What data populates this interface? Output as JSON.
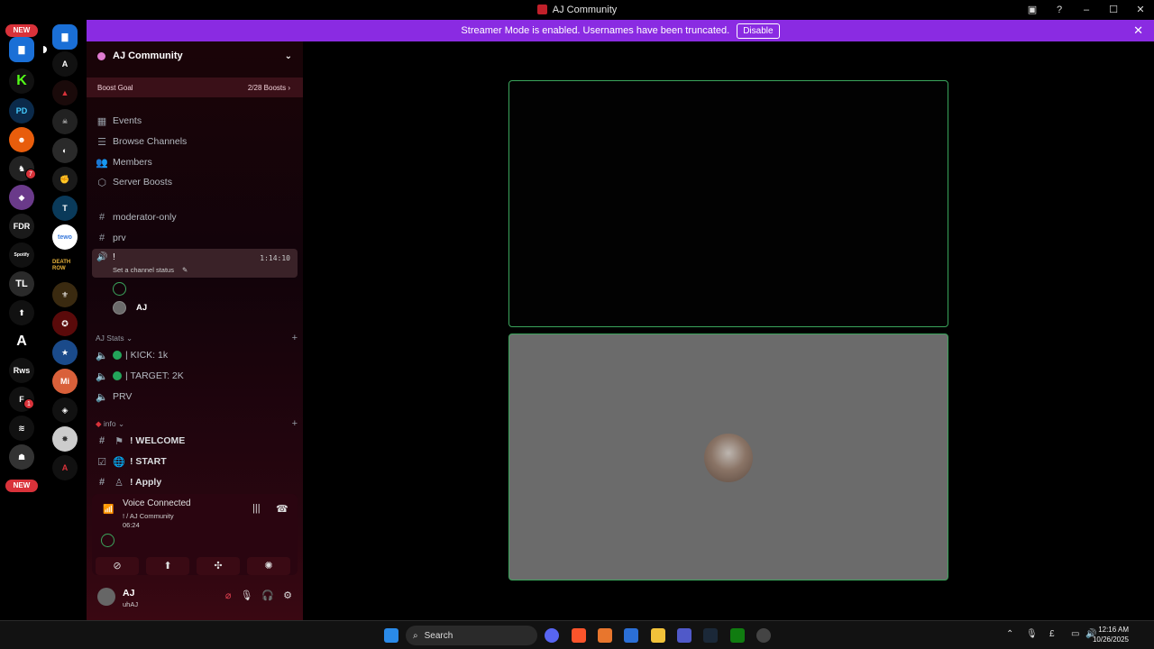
{
  "window": {
    "title": "AJ Community"
  },
  "banner": {
    "text": "Streamer Mode is enabled. Usernames have been truncated.",
    "disable_label": "Disable"
  },
  "rail": {
    "new_top": "NEW",
    "new_bottom": "NEW",
    "fdr": "FDR",
    "tl": "TL",
    "pd": "PD",
    "rws": "Rws",
    "death_row": "DEATH ROW",
    "mi": "Mi",
    "badge_7": "7",
    "badge_1": "1",
    "spotify": "Spotify",
    "tewo": "tewo"
  },
  "sidebar": {
    "server_name": "AJ Community",
    "boost_goal": "Boost Goal",
    "boost_count": "2/28 Boosts",
    "menu": [
      {
        "label": "Events",
        "icon": "calendar-icon"
      },
      {
        "label": "Browse Channels",
        "icon": "list-icon"
      },
      {
        "label": "Members",
        "icon": "members-icon"
      },
      {
        "label": "Server Boosts",
        "icon": "boost-icon"
      }
    ],
    "channels_top": [
      "moderator-only",
      "prv"
    ],
    "active_voice": {
      "name": "!",
      "status": "Set a channel status",
      "time": "1:14:10"
    },
    "voice_members": [
      "",
      "AJ"
    ],
    "cat_stats": "AJ Stats",
    "stats_channels": [
      "| KICK: 1k",
      "| TARGET: 2K",
      "PRV"
    ],
    "cat_info": "info",
    "info_channels": [
      "! WELCOME",
      "! START",
      "! Apply"
    ]
  },
  "voice_panel": {
    "status": "Voice Connected",
    "channel": "! / AJ Community",
    "elapsed": "06:24"
  },
  "user_panel": {
    "name": "AJ",
    "status": "uhAJ"
  },
  "taskbar": {
    "search_placeholder": "Search",
    "time": "12:16 AM",
    "date": "10/26/2025"
  },
  "colors": {
    "banner": "#8a2be2",
    "speaking": "#3ba55c",
    "online": "#23a55a",
    "badge": "#d9323a"
  }
}
